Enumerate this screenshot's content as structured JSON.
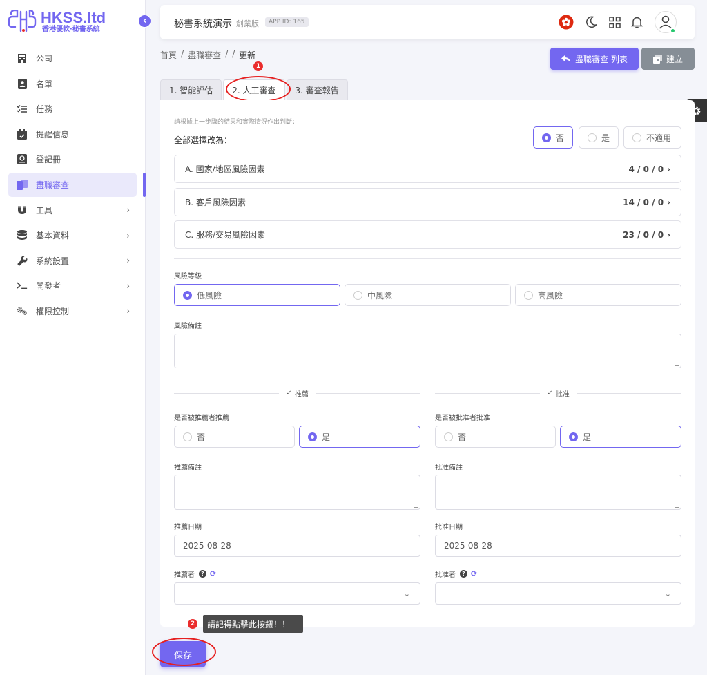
{
  "brand": {
    "name": "HKSS.ltd",
    "subtitle": "香港優軟·秘書系統",
    "color": "#7367f0"
  },
  "sidebar": {
    "items": [
      {
        "label": "公司",
        "icon": "building-icon",
        "expandable": false
      },
      {
        "label": "名單",
        "icon": "contact-card-icon",
        "expandable": false
      },
      {
        "label": "任務",
        "icon": "checklist-icon",
        "expandable": false
      },
      {
        "label": "提醒信息",
        "icon": "calendar-check-icon",
        "expandable": false
      },
      {
        "label": "登記冊",
        "icon": "register-book-icon",
        "expandable": false
      },
      {
        "label": "盡職審查",
        "icon": "documents-icon",
        "expandable": false,
        "active": true
      },
      {
        "label": "工具",
        "icon": "magnet-icon",
        "expandable": true
      },
      {
        "label": "基本資料",
        "icon": "database-icon",
        "expandable": true
      },
      {
        "label": "系統設置",
        "icon": "wrench-icon",
        "expandable": true
      },
      {
        "label": "開發者",
        "icon": "terminal-icon",
        "expandable": true
      },
      {
        "label": "權限控制",
        "icon": "cogs-icon",
        "expandable": true
      }
    ]
  },
  "topbar": {
    "title": "秘書系統演示",
    "edition": "創業版",
    "app_id": "APP ID: 165"
  },
  "breadcrumb": {
    "home": "首頁",
    "sep": "/",
    "section": "盡職審查",
    "current": "更新"
  },
  "actions": {
    "list_label": "盡職審查 列表",
    "create_label": "建立"
  },
  "tabs": [
    {
      "label": "1. 智能評估",
      "active": false
    },
    {
      "label": "2. 人工審查",
      "active": true
    },
    {
      "label": "3. 審查報告",
      "active": false
    }
  ],
  "annotations": {
    "badge1": "1",
    "badge2": "2",
    "tooltip": "請記得點擊此按鈕！！"
  },
  "form": {
    "hint": "請根據上一步驟的結果和實際情況作出判斷：",
    "select_all_label": "全部選擇改為：",
    "select_all_options": [
      {
        "label": "否",
        "selected": true
      },
      {
        "label": "是",
        "selected": false
      },
      {
        "label": "不適用",
        "selected": false
      }
    ],
    "sections": [
      {
        "label": "A. 國家/地區風險因素",
        "count": "4 / 0 / 0"
      },
      {
        "label": "B. 客戶風險因素",
        "count": "14 / 0 / 0"
      },
      {
        "label": "C. 服務/交易風險因素",
        "count": "23 / 0 / 0"
      }
    ],
    "risk_level_label": "風險等級",
    "risk_levels": [
      {
        "label": "低風險",
        "selected": true
      },
      {
        "label": "中風險",
        "selected": false
      },
      {
        "label": "高風險",
        "selected": false
      }
    ],
    "risk_note_label": "風險備註",
    "recommend": {
      "divider": "推薦",
      "question": "是否被推薦者推薦",
      "options": [
        {
          "label": "否",
          "selected": false
        },
        {
          "label": "是",
          "selected": true
        }
      ],
      "note_label": "推薦備註",
      "date_label": "推薦日期",
      "date_value": "2025-08-28",
      "person_label": "推薦者"
    },
    "approve": {
      "divider": "批准",
      "question": "是否被批准者批准",
      "options": [
        {
          "label": "否",
          "selected": false
        },
        {
          "label": "是",
          "selected": true
        }
      ],
      "note_label": "批准備註",
      "date_label": "批准日期",
      "date_value": "2025-08-28",
      "person_label": "批准者"
    },
    "save_label": "保存"
  }
}
